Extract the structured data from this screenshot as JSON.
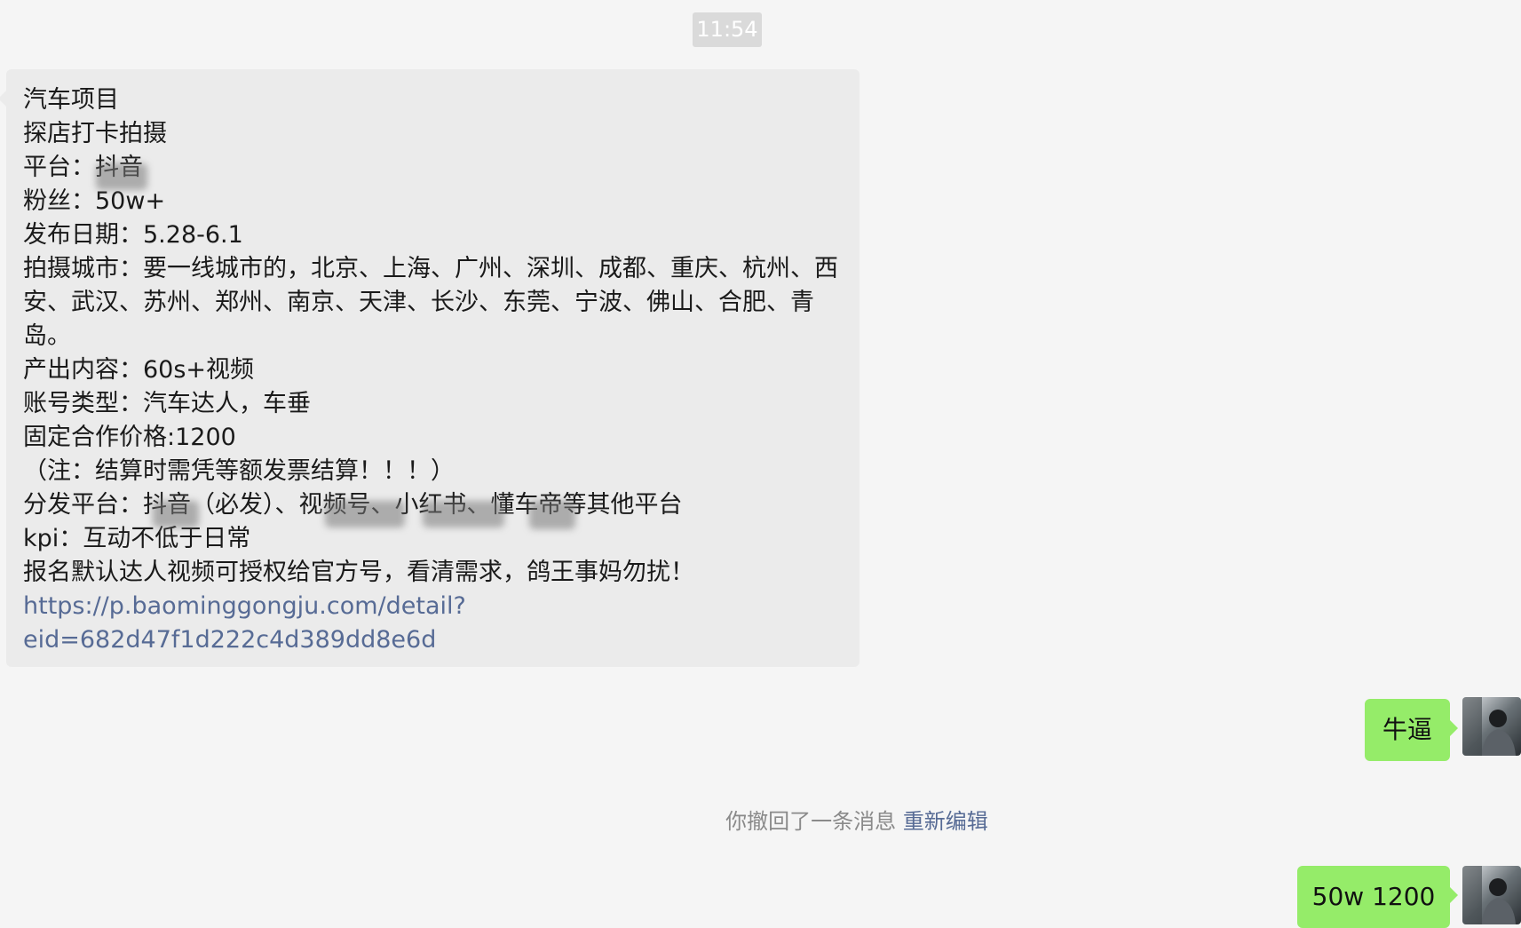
{
  "timestamp": "11:54",
  "incoming_message": {
    "lines": [
      "汽车项目",
      "探店打卡拍摄",
      "平台：抖音",
      "粉丝：50w+",
      "发布日期：5.28-6.1",
      "拍摄城市：要一线城市的，北京、上海、广州、深圳、成都、重庆、杭州、西",
      "安、武汉、苏州、郑州、南京、天津、长沙、东莞、宁波、佛山、合肥、青",
      "岛。",
      "产出内容：60s+视频",
      "账号类型：汽车达人，车垂",
      "固定合作价格:1200",
      "（注：结算时需凭等额发票结算！！！）",
      "分发平台：抖音（必发）、视频号、小红书、懂车帝等其他平台",
      "kpi：互动不低于日常",
      "报名默认达人视频可授权给官方号，看清需求，鸽王事妈勿扰！"
    ],
    "link_lines": [
      "https://p.baominggongju.com/detail?",
      "eid=682d47f1d222c4d389dd8e6d"
    ]
  },
  "outgoing_1": {
    "text": "牛逼"
  },
  "recall_notice": {
    "text": "你撤回了一条消息",
    "reedit_label": "重新编辑"
  },
  "outgoing_2": {
    "text": "50w 1200"
  },
  "colors": {
    "background": "#f5f5f5",
    "incoming_bubble": "#ebebeb",
    "outgoing_bubble": "#95ec69",
    "link": "#576b95",
    "timestamp_bg": "#dadada"
  }
}
